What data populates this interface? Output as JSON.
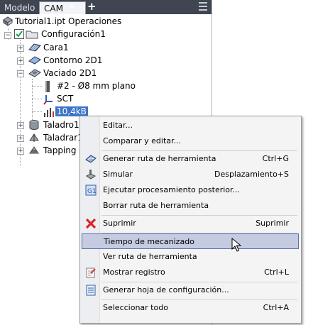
{
  "tabs": {
    "modelo": "Modelo",
    "cam": "CAM",
    "close": "×",
    "add": "+"
  },
  "tree": {
    "root": "Tutorial1.ipt Operaciones",
    "config": "Configuración1",
    "items": [
      {
        "label": "Cara1"
      },
      {
        "label": "Contorno 2D1"
      },
      {
        "label": "Vaciado 2D1"
      }
    ],
    "vaciado_children": [
      "#2 - Ø8 mm plano",
      "SCT",
      "10,4kB"
    ],
    "after": [
      "Taladro1",
      "Taladrar1",
      "Tapping"
    ]
  },
  "menu": {
    "editar": "Editar...",
    "comparar": "Comparar y editar...",
    "generar_ruta": "Generar ruta de herramienta",
    "generar_ruta_sc": "Ctrl+G",
    "simular": "Simular",
    "simular_sc": "Desplazamiento+S",
    "post": "Ejecutar procesamiento posterior...",
    "borrar": "Borrar ruta de herramienta",
    "suprimir": "Suprimir",
    "suprimir_sc": "Suprimir",
    "tiempo": "Tiempo de mecanizado",
    "ver_ruta": "Ver ruta de herramienta",
    "registro": "Mostrar registro",
    "registro_sc": "Ctrl+L",
    "hoja": "Generar hoja de configuración...",
    "seleccionar": "Seleccionar todo",
    "seleccionar_sc": "Ctrl+A"
  },
  "colors": {
    "tabbar": "#3f4652",
    "highlight": "#c5cbe1",
    "selection": "#3b74c9"
  }
}
